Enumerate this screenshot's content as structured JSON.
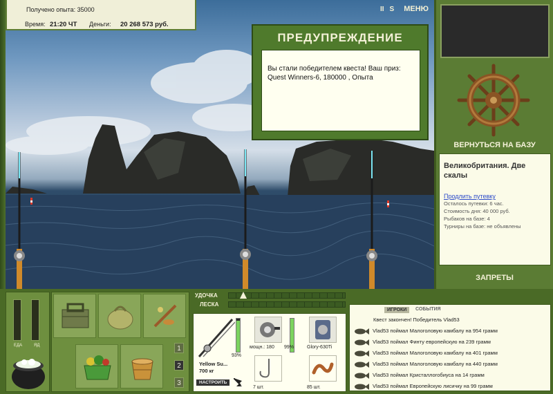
{
  "hud": {
    "exp_label": "Получено опыта: 35000",
    "time_label": "Время:",
    "time_value": "21:20 ЧТ",
    "money_label": "Деньги:",
    "money_value": "20 268 573 руб."
  },
  "top_icons": {
    "pause": "II",
    "sound": "S",
    "menu": "МЕНЮ"
  },
  "warning": {
    "title": "ПРЕДУПРЕЖДЕНИЕ",
    "message": "Вы стали победителем квеста! Ваш приз: Quest Winners-6, 180000 , Опыта"
  },
  "right_panel": {
    "return_label": "ВЕРНУТЬСЯ НА БАЗУ",
    "location": "Великобритания. Две скалы",
    "extend_link": "Продлить путевку",
    "info_lines": [
      "Осталось путевки: 6 час.",
      "Стоимость дня: 40 000 руб.",
      "Рыбаков на базе: 4",
      "Турниры на базе: не объявлены"
    ],
    "bans_label": "ЗАПРЕТЫ"
  },
  "bottom": {
    "food_label": "ЕДА",
    "bait_label": "ЯД",
    "nums": [
      "1",
      "2",
      "3"
    ],
    "rod_label": "УДОЧКА",
    "line_label": "ЛЕСКА",
    "rod_name": "Yellow Su...",
    "rod_weight": "700 кг",
    "rod_percent": "93%",
    "rod_percent_value": 0.93,
    "setup_label": "НАСТРОИТЬ",
    "reel_power": "мощн.: 180",
    "reel_percent": "99%",
    "reel_percent_value": 0.99,
    "line_name": "Glory-630Ti",
    "hooks_count": "7 шт.",
    "bait_count": "85 шт."
  },
  "events": {
    "tab_players": "ИГРОКИ",
    "tab_events": "СОБЫТИЯ",
    "header": "Квест закончен! Победитель Vlad53",
    "items": [
      "Vlad53 поймал Малоголовую камбалу на 954 грамм",
      "Vlad53 поймал Финту европейскую на 239 грамм",
      "Vlad53 поймал Малоголовую камбалу на 401 грамм",
      "Vlad53 поймал Малоголовую камбалу на 440 грамм",
      "Vlad53 поймал Кристаллогобиуса на 14 грамм",
      "Vlad53 поймал Европейскую лисичку на 99 грамм"
    ]
  }
}
